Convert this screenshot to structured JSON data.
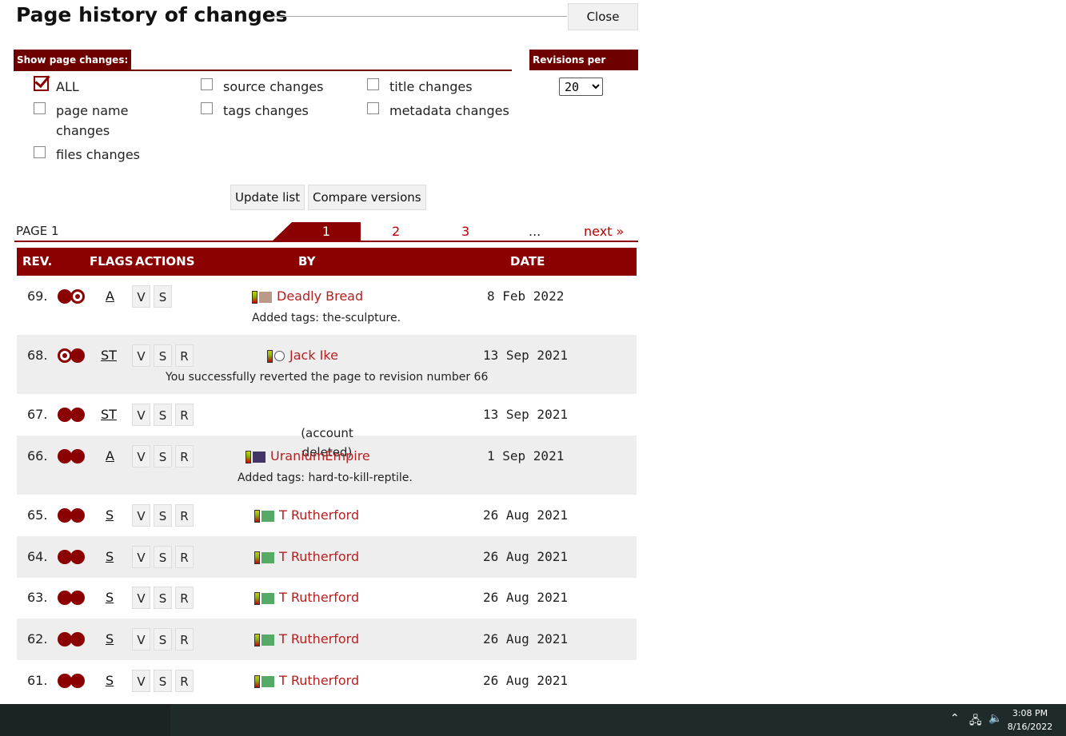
{
  "header": {
    "title": "Page history of changes",
    "close_label": "Close"
  },
  "filters": {
    "label": "Show page changes:",
    "options": [
      {
        "label": "ALL",
        "checked": true
      },
      {
        "label": "source changes",
        "checked": false
      },
      {
        "label": "title changes",
        "checked": false
      },
      {
        "label": "page name",
        "label2": "changes",
        "checked": false
      },
      {
        "label": "tags changes",
        "checked": false
      },
      {
        "label": "metadata changes",
        "checked": false
      },
      {
        "label": "files changes",
        "checked": false
      }
    ]
  },
  "revisions_per_page": {
    "label": "Revisions per page:",
    "value": "20"
  },
  "buttons": {
    "update": "Update list",
    "compare": "Compare versions"
  },
  "pagination": {
    "page_label": "PAGE 1",
    "active": "1",
    "pages": [
      "2",
      "3",
      "..."
    ],
    "next": "next »"
  },
  "table": {
    "headers": {
      "rev": "REV.",
      "flags": "FLAGS",
      "actions": "ACTIONS",
      "by": "BY",
      "date": "DATE"
    },
    "rows": [
      {
        "rev": "69.",
        "flags": "A",
        "user": "Deadly Bread",
        "date": "8 Feb 2022",
        "comment": "Added tags: the-sculpture."
      },
      {
        "rev": "68.",
        "flags": "ST",
        "user": "Jack Ike",
        "date": "13 Sep 2021",
        "comment": "You successfully reverted the page to revision number 66"
      },
      {
        "rev": "67.",
        "flags": "ST",
        "user": "",
        "date": "13 Sep 2021",
        "comment": ""
      },
      {
        "rev": "66.",
        "flags": "A",
        "user": "UraniumEmpire",
        "date": "1 Sep 2021",
        "comment": "Added tags: hard-to-kill-reptile."
      },
      {
        "rev": "65.",
        "flags": "S",
        "user": "T Rutherford",
        "date": "26 Aug 2021",
        "comment": ""
      },
      {
        "rev": "64.",
        "flags": "S",
        "user": "T Rutherford",
        "date": "26 Aug 2021",
        "comment": ""
      },
      {
        "rev": "63.",
        "flags": "S",
        "user": "T Rutherford",
        "date": "26 Aug 2021",
        "comment": ""
      },
      {
        "rev": "62.",
        "flags": "S",
        "user": "T Rutherford",
        "date": "26 Aug 2021",
        "comment": ""
      },
      {
        "rev": "61.",
        "flags": "S",
        "user": "T Rutherford",
        "date": "26 Aug 2021",
        "comment": ""
      }
    ],
    "action_labels": {
      "view": "V",
      "source": "S",
      "revert": "R"
    },
    "deleted_note": "(account deleted)"
  },
  "colors": {
    "accent": "#8b0000",
    "link": "#b22222"
  },
  "taskbar": {
    "time": "3:08 PM",
    "date": "8/16/2022"
  }
}
